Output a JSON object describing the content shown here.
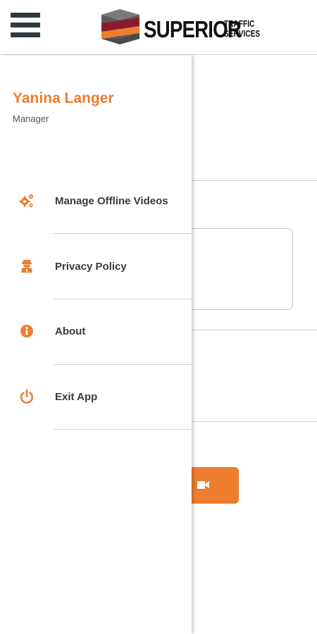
{
  "brand": {
    "name": "SUPERIOR",
    "sub_line1": "TRAFFIC",
    "sub_line2": "SERVICES",
    "accent_color": "#ee7d2f",
    "dark_color": "#2e3a3d"
  },
  "user": {
    "name": "Yanina Langer",
    "role": "Manager"
  },
  "menu": [
    {
      "label": "Manage Offline Videos",
      "icon": "gears-icon"
    },
    {
      "label": "Privacy Policy",
      "icon": "privacy-agent-icon"
    },
    {
      "label": "About",
      "icon": "info-icon"
    },
    {
      "label": "Exit App",
      "icon": "power-icon"
    }
  ]
}
